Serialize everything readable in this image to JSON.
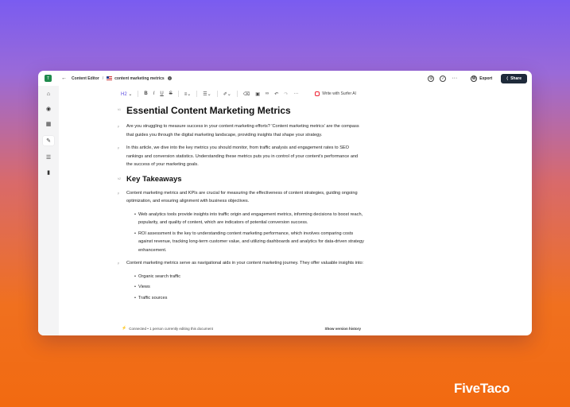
{
  "topbar": {
    "app_badge": "T",
    "breadcrumb_root": "Content Editor",
    "separator": "/",
    "doc_name": "content marketing metrics",
    "export_label": "Export",
    "share_label": "Share"
  },
  "toolbar": {
    "heading_label": "H2",
    "surfer_label": "Write with Surfer AI"
  },
  "document": {
    "title_tag": "h1",
    "title": "Essential Content Marketing Metrics",
    "p1_tag": "p",
    "p1": "Are you struggling to measure success in your content marketing efforts? 'Content marketing metrics' are the compass that guides you through the digital marketing landscape, providing insights that shape your strategy.",
    "p2_tag": "p",
    "p2": "In this article, we dive into the key metrics you should monitor, from traffic analysis and engagement rates to SEO rankings and conversion statistics. Understanding these metrics puts you in control of your content's performance and the success of your marketing goals.",
    "h2_tag": "h2",
    "h2": "Key Takeaways",
    "p3_tag": "p",
    "p3": "Content marketing metrics and KPIs are crucial for measuring the effectiveness of content strategies, guiding ongoing optimization, and ensuring alignment with business objectives.",
    "bullets1": [
      "Web analytics tools provide insights into traffic origin and engagement metrics, informing decisions to boost reach, popularity, and quality of content, which are indicators of potential conversion success.",
      "ROI assessment is the key to understanding content marketing performance, which involves comparing costs against revenue, tracking long-term customer value, and utilizing dashboards and analytics for data-driven strategy enhancement."
    ],
    "p4_tag": "p",
    "p4": "Content marketing metrics serve as navigational aids in your content marketing journey. They offer valuable insights into:",
    "bullets2": [
      "Organic search traffic",
      "Views",
      "Traffic sources"
    ]
  },
  "status": {
    "connected": "Connected • 1 person currently editing this document",
    "version": "Show version history"
  },
  "brand": "FiveTaco",
  "colors": {
    "share_bg": "#1e2a3a",
    "badge": "#1f8a4c"
  }
}
